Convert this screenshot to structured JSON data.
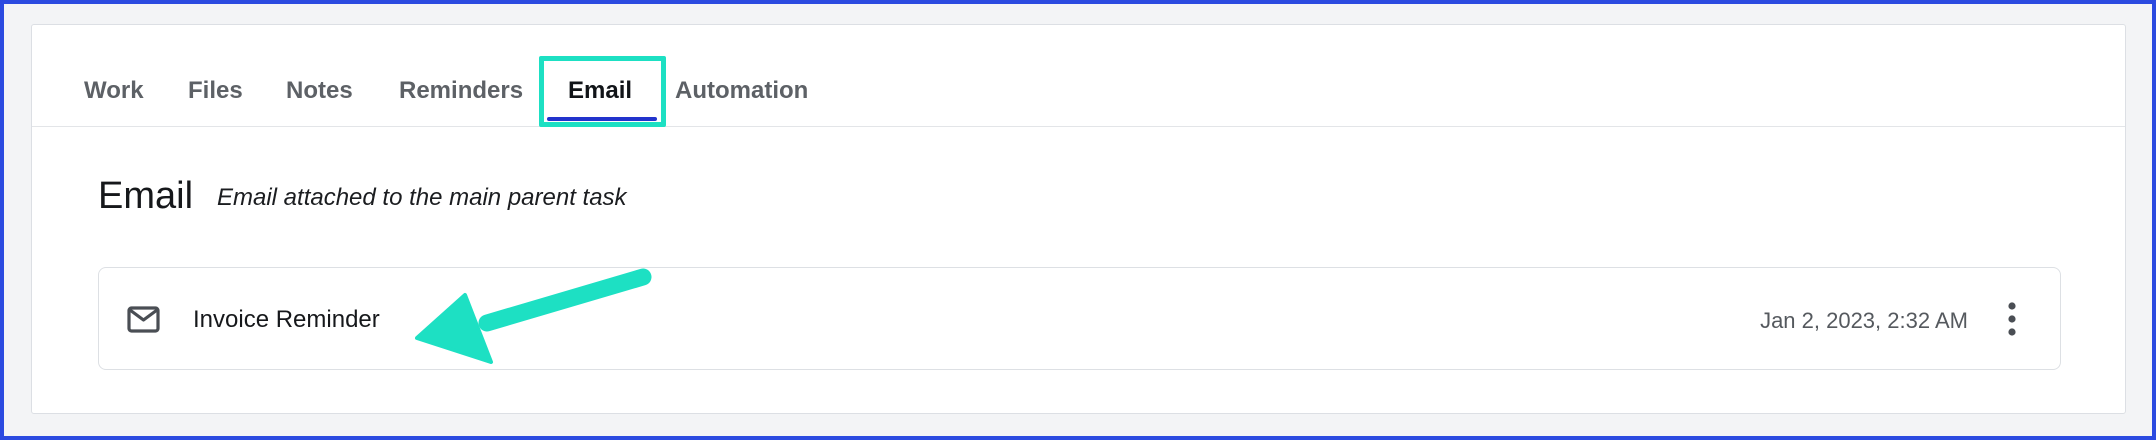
{
  "tabs": [
    {
      "label": "Work"
    },
    {
      "label": "Files"
    },
    {
      "label": "Notes"
    },
    {
      "label": "Reminders"
    },
    {
      "label": "Email",
      "active": true
    },
    {
      "label": "Automation"
    }
  ],
  "section": {
    "title": "Email",
    "subtitle": "Email attached to the main parent task"
  },
  "emails": [
    {
      "subject": "Invoice Reminder",
      "date": "Jan 2, 2023, 2:32 AM",
      "icon": "mail-icon"
    }
  ],
  "icons": {
    "row_menu": "more-vertical-icon",
    "annotation": "pointer-arrow-icon"
  },
  "colors": {
    "frame_border": "#2b4ae0",
    "highlight": "#1de0c3",
    "active_tab_underline": "#2233cc"
  }
}
